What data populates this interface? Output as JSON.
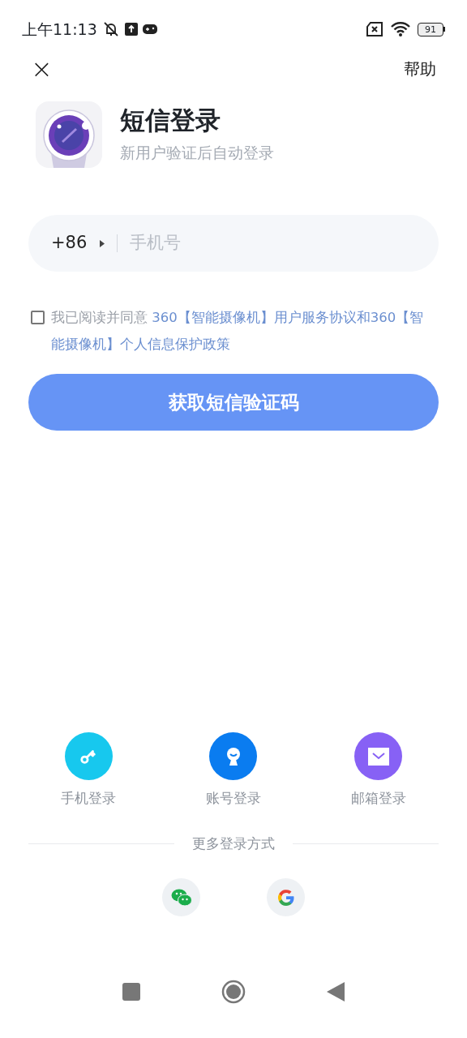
{
  "status_bar": {
    "time": "上午11:13",
    "battery": "91"
  },
  "header": {
    "close": "×",
    "help": "帮助"
  },
  "title": "短信登录",
  "subtitle": "新用户验证后自动登录",
  "phone_field": {
    "country_code": "+86",
    "placeholder": "手机号"
  },
  "agreement": {
    "checked": false,
    "prefix": "我已阅读并同意 ",
    "terms": "360【智能摄像机】用户服务协议和360【智能摄像机】个人信息保护政策"
  },
  "submit_button": "获取短信验证码",
  "login_methods": [
    {
      "kind": "key",
      "label": "手机登录",
      "color": "#17c8ee"
    },
    {
      "kind": "account",
      "label": "账号登录",
      "color": "#0a7cf0"
    },
    {
      "kind": "mail",
      "label": "邮箱登录",
      "color": "#8761f5"
    }
  ],
  "more_label": "更多登录方式",
  "social": [
    {
      "kind": "wechat"
    },
    {
      "kind": "google"
    }
  ]
}
